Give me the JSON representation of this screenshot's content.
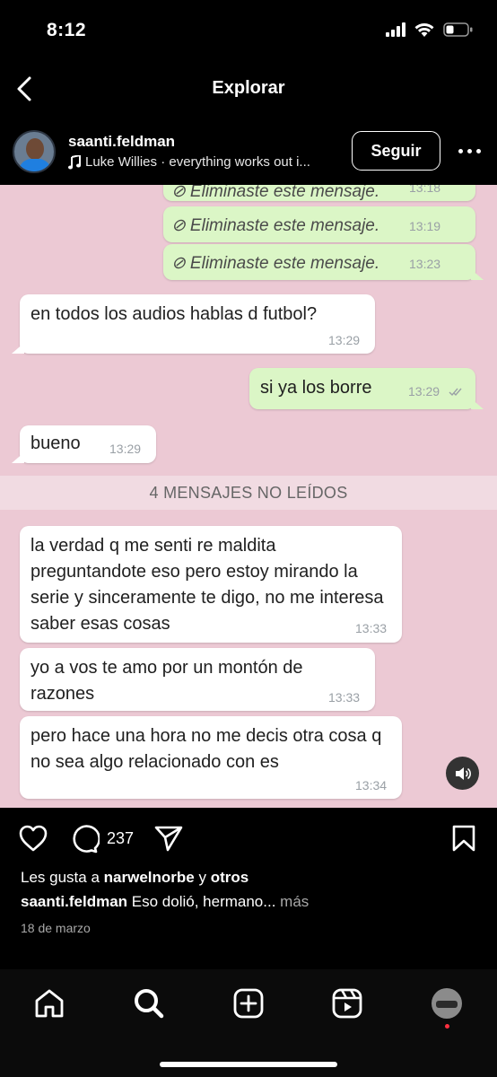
{
  "status_bar": {
    "time": "8:12"
  },
  "nav": {
    "title": "Explorar"
  },
  "post": {
    "username": "saanti.feldman",
    "music": "Luke Willies · everything works out i...",
    "follow_label": "Seguir"
  },
  "chat": {
    "deleted_label": "Eliminaste este mensaje.",
    "deleted_times": [
      "13:18",
      "13:19",
      "13:23"
    ],
    "messages": [
      {
        "text": "en todos los audios hablas d futbol?",
        "time": "13:29"
      },
      {
        "text": "si ya los borre",
        "time": "13:29"
      },
      {
        "text": "bueno",
        "time": "13:29"
      },
      {
        "text": "la verdad q me senti re maldita preguntandote eso pero estoy mirando la serie y sinceramente te digo, no me interesa saber esas cosas",
        "time": "13:33"
      },
      {
        "text": "yo a vos te amo por un montón de razones",
        "time": "13:33"
      },
      {
        "text": "pero hace una hora no me decis otra cosa q no sea algo relacionado con es",
        "time": "13:34"
      }
    ],
    "unread_banner": "4 MENSAJES NO LEÍDOS"
  },
  "actions": {
    "comment_count": "237"
  },
  "likes": {
    "prefix": "Les gusta a",
    "user": "narwelnorbe",
    "joiner": "y",
    "others": "otros"
  },
  "caption": {
    "user": "saanti.feldman",
    "text": "Eso dolió, hermano...",
    "more": "más"
  },
  "date": "18 de marzo",
  "colors": {
    "chat_bg": "#ecc9d4",
    "outgoing": "#dbf6c6",
    "incoming": "#ffffff",
    "notification_dot": "#ff3040"
  },
  "icons": [
    "back-chevron-icon",
    "music-note-icon",
    "more-dots-icon",
    "heart-icon",
    "comment-icon",
    "share-icon",
    "bookmark-icon",
    "home-icon",
    "search-icon",
    "create-icon",
    "reels-icon",
    "sound-icon",
    "blocked-icon"
  ]
}
